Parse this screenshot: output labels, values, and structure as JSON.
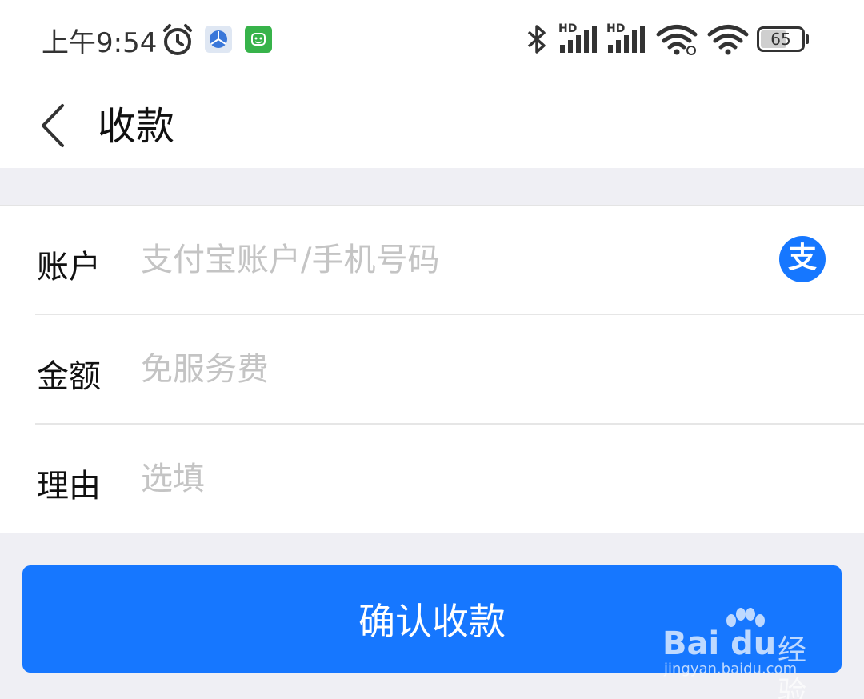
{
  "status_bar": {
    "time": "上午9:54",
    "signal_1_label": "HD",
    "signal_2_label": "HD",
    "battery_level": "65",
    "icons": [
      "alarm-icon",
      "app-icon",
      "app-icon",
      "bluetooth-icon",
      "signal-icon",
      "signal-icon",
      "wifi-icon",
      "wifi-icon",
      "battery-icon"
    ]
  },
  "header": {
    "title": "收款",
    "back_icon": "chevron-left-icon"
  },
  "form": {
    "account": {
      "label": "账户",
      "placeholder": "支付宝账户/手机号码",
      "value": "",
      "icon": "alipay-icon",
      "icon_glyph": "支"
    },
    "amount": {
      "label": "金额",
      "placeholder": "免服务费",
      "value": ""
    },
    "reason": {
      "label": "理由",
      "placeholder": "选填",
      "value": ""
    }
  },
  "actions": {
    "confirm_label": "确认收款"
  },
  "watermark": {
    "brand": "Bai du",
    "brand_suffix": "经验",
    "url": "jingyan.baidu.com"
  },
  "colors": {
    "accent": "#1677ff",
    "background": "#efeff4",
    "placeholder": "#c4c4c4"
  }
}
